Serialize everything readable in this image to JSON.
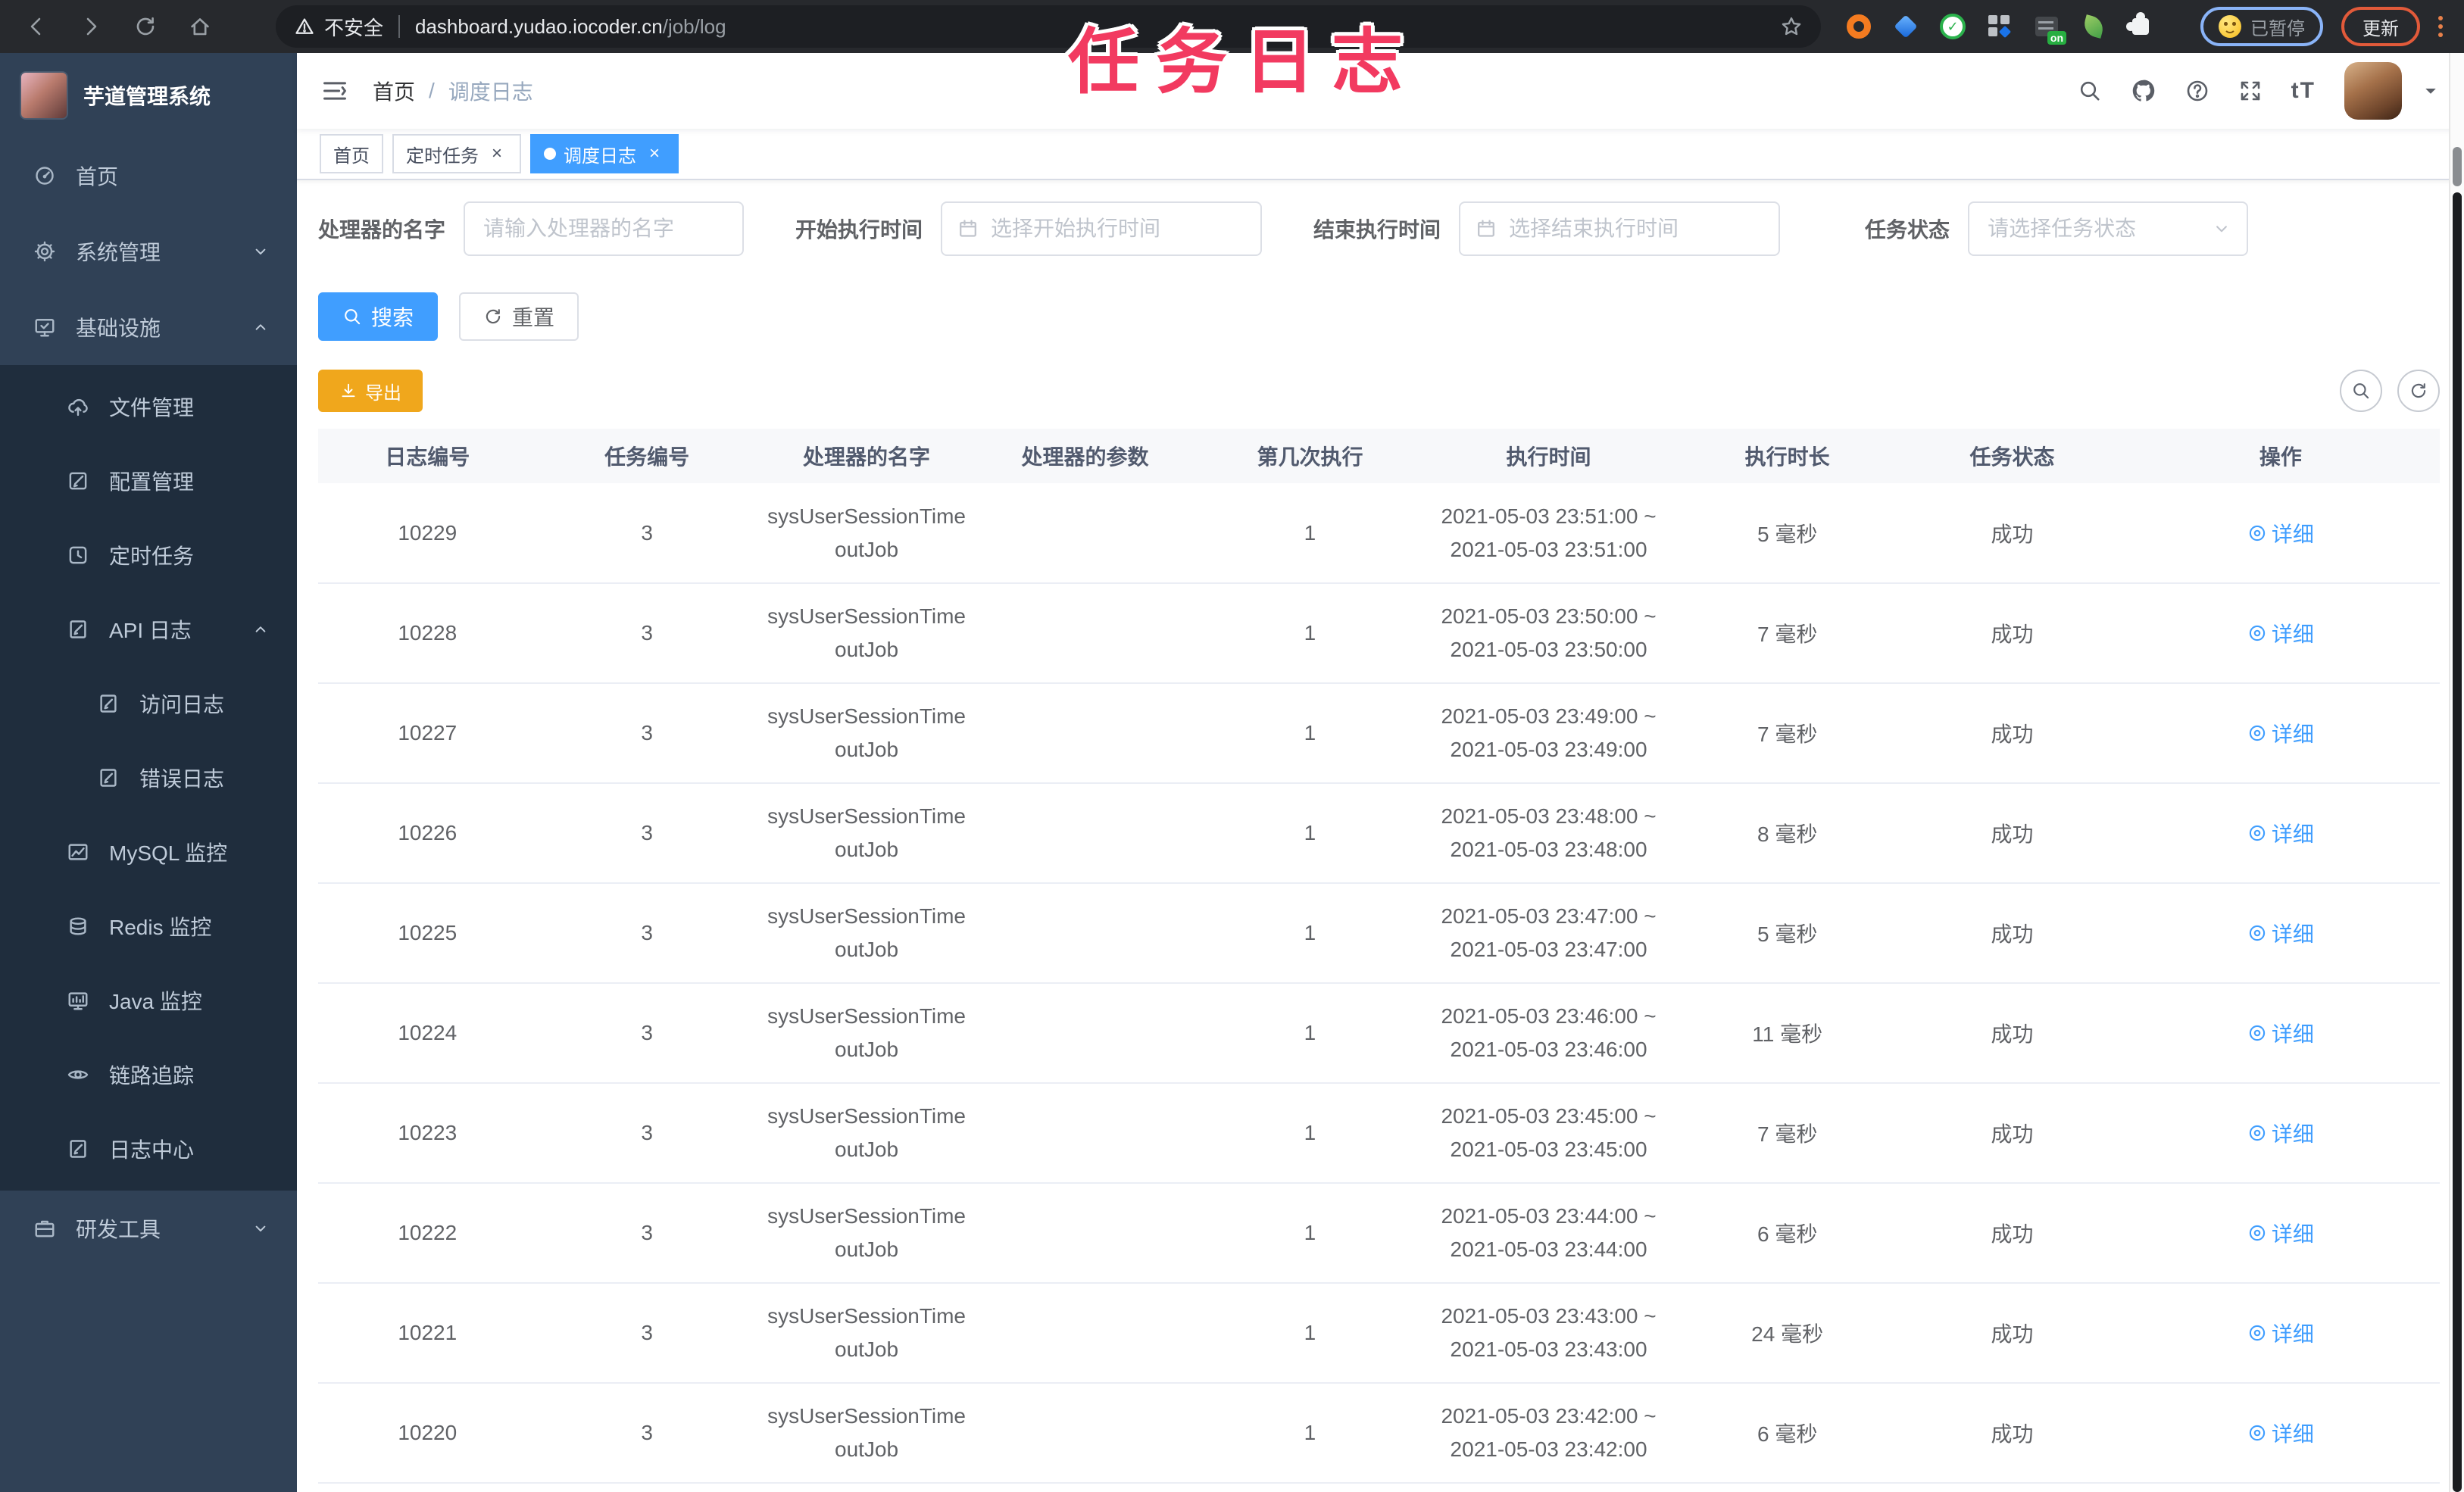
{
  "overlay_title": "任务日志",
  "browser": {
    "security_label": "不安全",
    "url_host": "dashboard.yudao.iocoder.cn",
    "url_path": "/job/log",
    "paused_label": "已暂停",
    "update_label": "更新",
    "extension_badge": "on"
  },
  "sidebar": {
    "app_title": "芋道管理系统",
    "items": [
      {
        "label": "首页",
        "icon": "dashboard",
        "level": 1,
        "chevron": ""
      },
      {
        "label": "系统管理",
        "icon": "gear",
        "level": 1,
        "chevron": "down"
      },
      {
        "label": "基础设施",
        "icon": "monitor-check",
        "level": 1,
        "chevron": "up"
      },
      {
        "label": "文件管理",
        "icon": "cloud-upload",
        "level": 2,
        "chevron": ""
      },
      {
        "label": "配置管理",
        "icon": "edit-square",
        "level": 2,
        "chevron": ""
      },
      {
        "label": "定时任务",
        "icon": "timer",
        "level": 2,
        "chevron": ""
      },
      {
        "label": "API 日志",
        "icon": "doc-edit",
        "level": 2,
        "chevron": "up"
      },
      {
        "label": "访问日志",
        "icon": "doc-edit",
        "level": 3,
        "chevron": ""
      },
      {
        "label": "错误日志",
        "icon": "doc-edit",
        "level": 3,
        "chevron": ""
      },
      {
        "label": "MySQL 监控",
        "icon": "chart-image",
        "level": 2,
        "chevron": ""
      },
      {
        "label": "Redis 监控",
        "icon": "layers",
        "level": 2,
        "chevron": ""
      },
      {
        "label": "Java 监控",
        "icon": "monitor",
        "level": 2,
        "chevron": ""
      },
      {
        "label": "链路追踪",
        "icon": "eye",
        "level": 2,
        "chevron": ""
      },
      {
        "label": "日志中心",
        "icon": "doc-edit",
        "level": 2,
        "chevron": ""
      },
      {
        "label": "研发工具",
        "icon": "briefcase",
        "level": 1,
        "chevron": "down"
      }
    ]
  },
  "navbar": {
    "breadcrumb": [
      "首页",
      "调度日志"
    ],
    "separator": "/",
    "font_size_label": "tT"
  },
  "tabs": [
    {
      "label": "首页",
      "active": false,
      "closable": false
    },
    {
      "label": "定时任务",
      "active": false,
      "closable": true
    },
    {
      "label": "调度日志",
      "active": true,
      "closable": true
    }
  ],
  "filters": [
    {
      "label": "处理器的名字",
      "type": "text",
      "placeholder": "请输入处理器的名字"
    },
    {
      "label": "开始执行时间",
      "type": "date",
      "placeholder": "选择开始执行时间"
    },
    {
      "label": "结束执行时间",
      "type": "date",
      "placeholder": "选择结束执行时间"
    },
    {
      "label": "任务状态",
      "type": "select",
      "placeholder": "请选择任务状态"
    }
  ],
  "actions": {
    "search": "搜索",
    "reset": "重置",
    "export": "导出"
  },
  "table": {
    "columns": [
      "日志编号",
      "任务编号",
      "处理器的名字",
      "处理器的参数",
      "第几次执行",
      "执行时间",
      "执行时长",
      "任务状态",
      "操作"
    ],
    "action_label": "详细",
    "time_separator": "~",
    "rows": [
      {
        "log_id": "10229",
        "job_id": "3",
        "handler": "sysUserSessionTimeoutJob",
        "param": "",
        "count": "1",
        "begin": "2021-05-03 23:51:00",
        "end": "2021-05-03 23:51:00",
        "duration": "5 毫秒",
        "status": "成功"
      },
      {
        "log_id": "10228",
        "job_id": "3",
        "handler": "sysUserSessionTimeoutJob",
        "param": "",
        "count": "1",
        "begin": "2021-05-03 23:50:00",
        "end": "2021-05-03 23:50:00",
        "duration": "7 毫秒",
        "status": "成功"
      },
      {
        "log_id": "10227",
        "job_id": "3",
        "handler": "sysUserSessionTimeoutJob",
        "param": "",
        "count": "1",
        "begin": "2021-05-03 23:49:00",
        "end": "2021-05-03 23:49:00",
        "duration": "7 毫秒",
        "status": "成功"
      },
      {
        "log_id": "10226",
        "job_id": "3",
        "handler": "sysUserSessionTimeoutJob",
        "param": "",
        "count": "1",
        "begin": "2021-05-03 23:48:00",
        "end": "2021-05-03 23:48:00",
        "duration": "8 毫秒",
        "status": "成功"
      },
      {
        "log_id": "10225",
        "job_id": "3",
        "handler": "sysUserSessionTimeoutJob",
        "param": "",
        "count": "1",
        "begin": "2021-05-03 23:47:00",
        "end": "2021-05-03 23:47:00",
        "duration": "5 毫秒",
        "status": "成功"
      },
      {
        "log_id": "10224",
        "job_id": "3",
        "handler": "sysUserSessionTimeoutJob",
        "param": "",
        "count": "1",
        "begin": "2021-05-03 23:46:00",
        "end": "2021-05-03 23:46:00",
        "duration": "11 毫秒",
        "status": "成功"
      },
      {
        "log_id": "10223",
        "job_id": "3",
        "handler": "sysUserSessionTimeoutJob",
        "param": "",
        "count": "1",
        "begin": "2021-05-03 23:45:00",
        "end": "2021-05-03 23:45:00",
        "duration": "7 毫秒",
        "status": "成功"
      },
      {
        "log_id": "10222",
        "job_id": "3",
        "handler": "sysUserSessionTimeoutJob",
        "param": "",
        "count": "1",
        "begin": "2021-05-03 23:44:00",
        "end": "2021-05-03 23:44:00",
        "duration": "6 毫秒",
        "status": "成功"
      },
      {
        "log_id": "10221",
        "job_id": "3",
        "handler": "sysUserSessionTimeoutJob",
        "param": "",
        "count": "1",
        "begin": "2021-05-03 23:43:00",
        "end": "2021-05-03 23:43:00",
        "duration": "24 毫秒",
        "status": "成功"
      },
      {
        "log_id": "10220",
        "job_id": "3",
        "handler": "sysUserSessionTimeoutJob",
        "param": "",
        "count": "1",
        "begin": "2021-05-03 23:42:00",
        "end": "2021-05-03 23:42:00",
        "duration": "6 毫秒",
        "status": "成功"
      }
    ]
  },
  "colors": {
    "accent": "#409eff",
    "warning": "#f0a71c",
    "overlay": "#f23a60",
    "sidebar_bg": "#304156",
    "submenu_bg": "#1f2d3d",
    "success_text": "#606266"
  }
}
